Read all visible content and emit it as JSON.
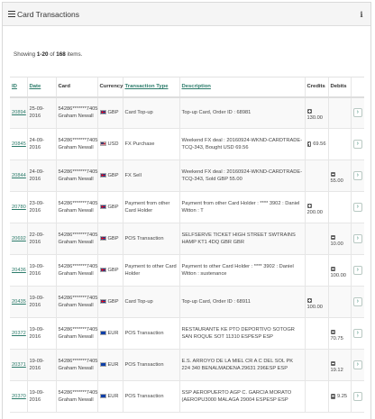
{
  "panel": {
    "title": "Card Transactions",
    "list_icon": "list-icon",
    "info_icon": "info-icon"
  },
  "summary": {
    "prefix": "Showing ",
    "range": "1-20",
    "of": " of ",
    "total": "168",
    "suffix": " items."
  },
  "columns": {
    "id": "ID",
    "date": "Date",
    "card": "Card",
    "currency": "Currency",
    "transaction_type": "Transaction Type",
    "description": "Description",
    "credits": "Credits",
    "debits": "Debits"
  },
  "colors": {
    "link": "#2d7c6b",
    "action_border": "#b9c9c3"
  },
  "rows": [
    {
      "id": "20894",
      "date": "25-09-2016",
      "card": "54286*******7405",
      "holder": "Graham Newall",
      "currency": "GBP",
      "flag": "gbp",
      "type": "Card Top-up",
      "description": "Top-up Card, Order ID : 68981",
      "credit": "130.00",
      "debit": "",
      "action": "›"
    },
    {
      "id": "20845",
      "date": "24-09-2016",
      "card": "54286*******7405",
      "holder": "Graham Newall",
      "currency": "USD",
      "flag": "usd",
      "type": "FX Purchase",
      "description": "Weekend FX deal : 20160924-WKND-CARDTRADE-TCQ-343, Bought USD 69.56",
      "credit": "69.56",
      "debit": "",
      "action": "›"
    },
    {
      "id": "20844",
      "date": "24-09-2016",
      "card": "54286*******7405",
      "holder": "Graham Newall",
      "currency": "GBP",
      "flag": "gbp",
      "type": "FX Sell",
      "description": "Weekend FX deal : 20160924-WKND-CARDTRADE-TCQ-343, Sold GBP 55.00",
      "credit": "",
      "debit": "55.00",
      "action": "›"
    },
    {
      "id": "20780",
      "date": "23-09-2016",
      "card": "54286*******7405",
      "holder": "Graham Newall",
      "currency": "GBP",
      "flag": "gbp",
      "type": "Payment from other Card Holder",
      "description": "Payment from other Card Holder : **** 3902 : Daniel Witton : T",
      "credit": "200.00",
      "debit": "",
      "action": "›"
    },
    {
      "id": "20692",
      "date": "22-09-2016",
      "card": "54286*******7405",
      "holder": "Graham Newall",
      "currency": "GBP",
      "flag": "gbp",
      "type": "POS Transaction",
      "description": "SELFSERVE TICKET HIGH STREET SWTRAINS HAMP KT1 4DQ GBR GBR",
      "credit": "",
      "debit": "10.00",
      "action": "›"
    },
    {
      "id": "20436",
      "date": "19-09-2016",
      "card": "54286*******7405",
      "holder": "Graham Newall",
      "currency": "GBP",
      "flag": "gbp",
      "type": "Payment to other Card Holder",
      "description": "Payment to other Card Holder : **** 3902 : Daniel Witton : sustenance",
      "credit": "",
      "debit": "100.00",
      "action": "›"
    },
    {
      "id": "20435",
      "date": "19-09-2016",
      "card": "54286*******7405",
      "holder": "Graham Newall",
      "currency": "GBP",
      "flag": "gbp",
      "type": "Card Top-up",
      "description": "Top-up Card, Order ID : 68911",
      "credit": "100.00",
      "debit": "",
      "action": "›"
    },
    {
      "id": "20372",
      "date": "19-09-2016",
      "card": "54286*******7405",
      "holder": "Graham Newall",
      "currency": "EUR",
      "flag": "eur",
      "type": "POS Transaction",
      "description": "RESTAURANTE KE PTO DEPORTIVO SOTOGR SAN ROQUE SOT 11310 ESPESP ESP",
      "credit": "",
      "debit": "70.75",
      "action": "›"
    },
    {
      "id": "20371",
      "date": "19-09-2016",
      "card": "54286*******7405",
      "holder": "Graham Newall",
      "currency": "EUR",
      "flag": "eur",
      "type": "POS Transaction",
      "description": "E.S. ARROYO DE LA MIEL CR A C DEL SOL PK 224 340 BENALMADENA 29631 296ESP ESP",
      "credit": "",
      "debit": "19.12",
      "action": "›"
    },
    {
      "id": "20370",
      "date": "19-09-2016",
      "card": "54286*******7405",
      "holder": "Graham Newall",
      "currency": "EUR",
      "flag": "eur",
      "type": "POS Transaction",
      "description": "SSP AEROPUERTO AGP C. GARCIA MORATO (AEROPU3000 MALAGA 29004 ESPESP ESP",
      "credit": "",
      "debit": "9.25",
      "action": "›"
    }
  ]
}
